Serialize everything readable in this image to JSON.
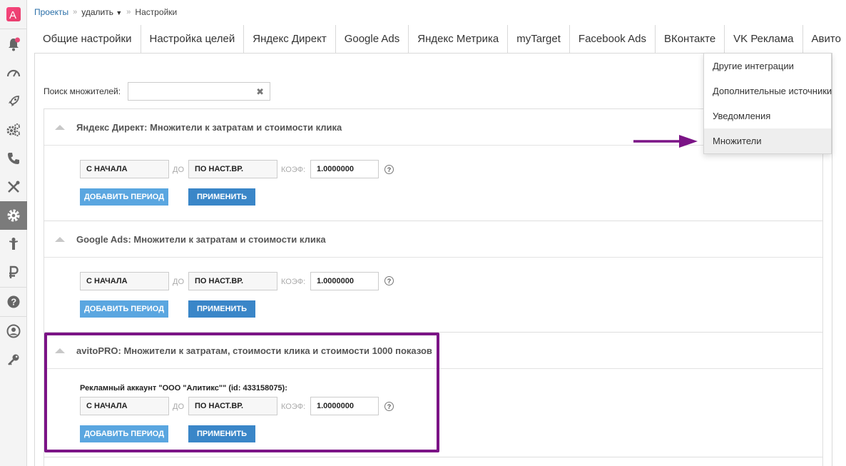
{
  "breadcrumb": {
    "projects": "Проекты",
    "project": "удалить",
    "current": "Настройки"
  },
  "sidebar": {
    "icons": [
      "logo-icon",
      "bell-icon",
      "speedometer-icon",
      "rocket-icon",
      "gears-icon",
      "phone-icon",
      "tools-icon",
      "gear-icon",
      "person-icon",
      "ruble-icon",
      "help-icon",
      "user-icon",
      "key-icon"
    ],
    "accent_color": "#e84a78",
    "active_color": "#7b7b7b"
  },
  "tabs": [
    "Общие настройки",
    "Настройка целей",
    "Яндекс Директ",
    "Google Ads",
    "Яндекс Метрика",
    "myTarget",
    "Facebook Ads",
    "ВКонтакте",
    "VK Реклама",
    "Авито"
  ],
  "more_icon": "kebab-menu-icon",
  "dropdown": {
    "items": [
      "Другие интеграции",
      "Дополнительные источники",
      "Уведомления",
      "Множители"
    ],
    "active_index": 3
  },
  "search": {
    "label": "Поиск множителей:",
    "value": "",
    "clear_glyph": "✖"
  },
  "annotation": {
    "color": "#7b1486"
  },
  "panels": [
    {
      "title": "Яндекс Директ: Множители к затратам и стоимости клика",
      "from": "С НАЧАЛА",
      "to_label": "ДО",
      "to": "ПО НАСТ.ВР.",
      "coef_label": "КОЭФ:",
      "coef": "1.0000000",
      "help": "?",
      "add_button": "ДОБАВИТЬ ПЕРИОД",
      "apply_button": "ПРИМЕНИТЬ"
    },
    {
      "title": "Google Ads: Множители к затратам и стоимости клика",
      "from": "С НАЧАЛА",
      "to_label": "ДО",
      "to": "ПО НАСТ.ВР.",
      "coef_label": "КОЭФ:",
      "coef": "1.0000000",
      "help": "?",
      "add_button": "ДОБАВИТЬ ПЕРИОД",
      "apply_button": "ПРИМЕНИТЬ"
    },
    {
      "title": "avitoPRO: Множители к затратам, стоимости клика и стоимости 1000 показов",
      "account": "Рекламный аккаунт \"ООО \"Алитикс\"\" (id: 433158075):",
      "from": "С НАЧАЛА",
      "to_label": "ДО",
      "to": "ПО НАСТ.ВР.",
      "coef_label": "КОЭФ:",
      "coef": "1.0000000",
      "help": "?",
      "add_button": "ДОБАВИТЬ ПЕРИОД",
      "apply_button": "ПРИМЕНИТЬ"
    }
  ]
}
